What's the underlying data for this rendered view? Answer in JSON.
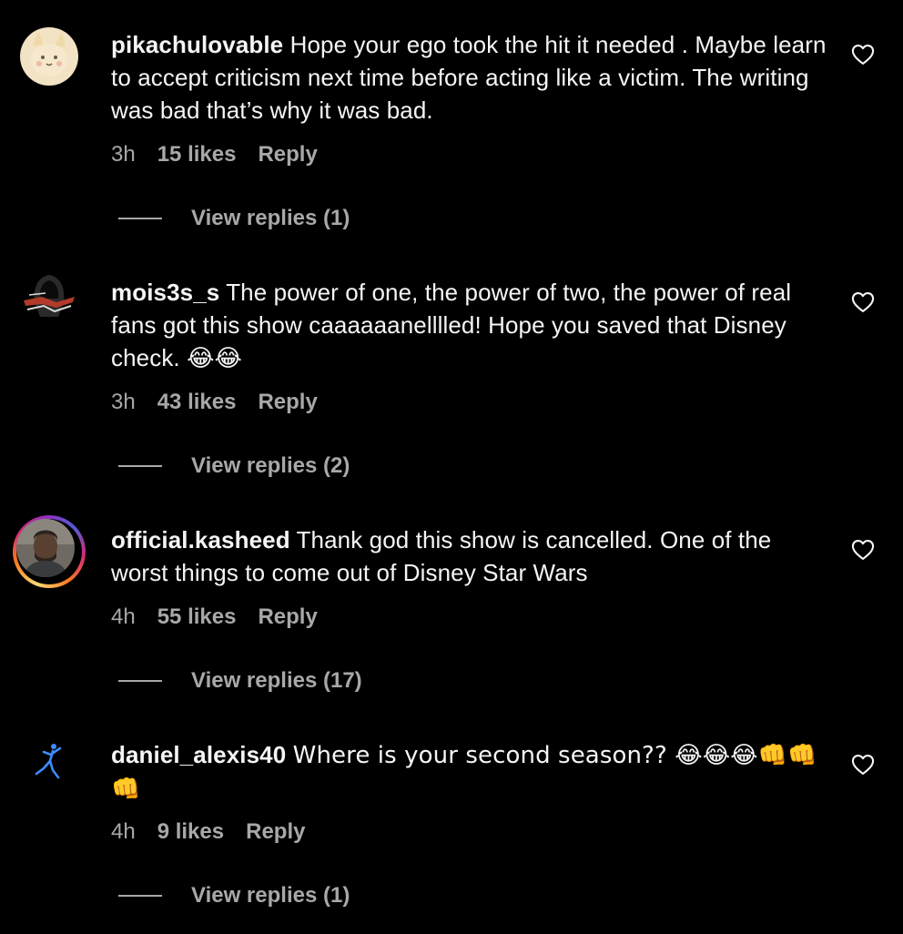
{
  "comments": [
    {
      "username": "pikachulovable",
      "text": "Hope your ego took the hit it needed . Maybe learn to accept criticism next time before acting like a victim. The writing was bad that’s why it was bad.",
      "time": "3h",
      "likes": "15 likes",
      "reply": "Reply",
      "view_replies": "View replies (1)",
      "avatar_icon": "pikachu-avatar",
      "liked": false
    },
    {
      "username": "mois3s_s",
      "text": "The power of one, the power of two, the power of real fans got this show caaaaaanelllled! Hope you saved that Disney check. 😂😂",
      "time": "3h",
      "likes": "43 likes",
      "reply": "Reply",
      "view_replies": "View replies (2)",
      "avatar_icon": "hooded-figure-avatar",
      "liked": false
    },
    {
      "username": "official.kasheed",
      "text": "Thank god this show is cancelled. One of the worst things to come out of Disney Star Wars",
      "time": "4h",
      "likes": "55 likes",
      "reply": "Reply",
      "view_replies": "View replies (17)",
      "avatar_icon": "portrait-avatar-story-ring",
      "liked": false
    },
    {
      "username": "daniel_alexis40",
      "text": "Where is your second season?? 😂😂😂👊👊👊",
      "time": "4h",
      "likes": "9 likes",
      "reply": "Reply",
      "view_replies": "View replies (1)",
      "avatar_icon": "jumpman-logo-avatar",
      "liked": false
    }
  ],
  "colors": {
    "background": "#000000",
    "primary_text": "#f5f5f5",
    "secondary_text": "#a8a8a8",
    "story_ring": [
      "#feda75",
      "#fa7e1e",
      "#d62976",
      "#962fbf",
      "#4f5bd5"
    ]
  }
}
